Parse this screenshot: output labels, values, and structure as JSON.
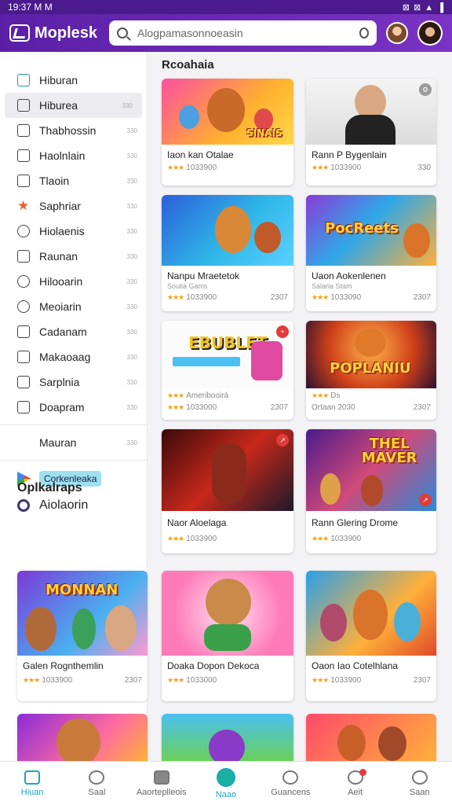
{
  "status": {
    "time": "19:37",
    "icons_left": "M M",
    "icons_right": "⊠ ⊠ ▲ ▐"
  },
  "header": {
    "app_name": "Moplesk",
    "search_placeholder": "Alogpamasonnoeasin"
  },
  "sidebar": {
    "items": [
      {
        "label": "Hiburan",
        "icon": "home-icon",
        "badge": ""
      },
      {
        "label": "Hiburea",
        "icon": "gamepad-icon",
        "badge": "330"
      },
      {
        "label": "Thabhossin",
        "icon": "square-icon",
        "badge": "330"
      },
      {
        "label": "Haolnlain",
        "icon": "folder-icon",
        "badge": "330"
      },
      {
        "label": "Tlaoin",
        "icon": "grid-icon",
        "badge": "330"
      },
      {
        "label": "Saphriar",
        "icon": "star-icon",
        "badge": "330"
      },
      {
        "label": "Hiolaenis",
        "icon": "clock-icon",
        "badge": "330"
      },
      {
        "label": "Raunan",
        "icon": "user-icon",
        "badge": "330"
      },
      {
        "label": "Hilooarin",
        "icon": "globe-icon",
        "badge": "330"
      },
      {
        "label": "Meoiarin",
        "icon": "circle-icon",
        "badge": "330"
      },
      {
        "label": "Cadanam",
        "icon": "bookmark-icon",
        "badge": "330"
      },
      {
        "label": "Makaoaag",
        "icon": "check-icon",
        "badge": "330"
      },
      {
        "label": "Sarplnia",
        "icon": "list-icon",
        "badge": "330"
      },
      {
        "label": "Doapram",
        "icon": "minus-box-icon",
        "badge": "330"
      }
    ],
    "extra": {
      "label": "Mauran",
      "badge": "330"
    },
    "chip": "Corkenleaka",
    "ring_item": "Aiolaorin",
    "section_title": "Oplkalraps"
  },
  "main": {
    "section_title": "Rcoahaia",
    "cards": [
      {
        "title": "Iaon kan Otalae",
        "sub": "",
        "rating": "★★★",
        "meta": "1033900",
        "meta_right": "",
        "thumb_text": "SINAIS"
      },
      {
        "title": "Rann P Bygenlain",
        "sub": "",
        "rating": "★★★",
        "meta": "1033900",
        "meta_right": "330",
        "thumb_text": ""
      },
      {
        "title": "Nanpu Mraetetok",
        "sub": "Soulia Gams",
        "rating": "★★★",
        "meta": "1033900",
        "meta_right": "2307",
        "thumb_text": ""
      },
      {
        "title": "Uaon Aokenlenen",
        "sub": "Salaria Stam",
        "rating": "★★★",
        "meta": "1033090",
        "meta_right": "2307",
        "thumb_text": "PocReets"
      },
      {
        "title": "Ameribooirá",
        "sub": "",
        "rating": "★★★",
        "meta": "1033000",
        "meta_right": "2307",
        "thumb_text": "EBUBLET"
      },
      {
        "title": "Ds",
        "sub": "",
        "rating": "★★★",
        "meta": "Ortaan 2030",
        "meta_right": "2307",
        "thumb_text": "POPLANIU"
      },
      {
        "title": "Naor Aloelaga",
        "sub": "",
        "rating": "★★★",
        "meta": "1033900",
        "meta_right": "",
        "thumb_text": ""
      },
      {
        "title": "Rann Glering Drome",
        "sub": "",
        "rating": "★★★",
        "meta": "1033900",
        "meta_right": "",
        "thumb_text": "THEL MAVER"
      },
      {
        "title": "Doaka Dopon Dekoca",
        "sub": "",
        "rating": "★★★",
        "meta": "1033000",
        "meta_right": "",
        "thumb_text": ""
      },
      {
        "title": "Oaon Iao Cotelhlana",
        "sub": "",
        "rating": "★★★",
        "meta": "1033900",
        "meta_right": "2307",
        "thumb_text": ""
      }
    ],
    "feature_card": {
      "title": "Galen Rognthemlin",
      "rating": "★★★",
      "meta": "1033900",
      "meta_right": "2307",
      "thumb_text": "MONNAN"
    }
  },
  "bottom_nav": [
    {
      "label": "Hiuan",
      "icon": "home-icon"
    },
    {
      "label": "Saal",
      "icon": "heart-icon"
    },
    {
      "label": "Aaorteplleois",
      "icon": "tablet-icon"
    },
    {
      "label": "Naao",
      "icon": "play-circle-icon"
    },
    {
      "label": "Guancens",
      "icon": "chat-icon"
    },
    {
      "label": "Aeit",
      "icon": "bell-icon"
    },
    {
      "label": "Saan",
      "icon": "person-icon"
    }
  ],
  "colors": {
    "header": "#5b1fa6",
    "accent": "#1aa7b8",
    "star": "#f2a30f"
  }
}
